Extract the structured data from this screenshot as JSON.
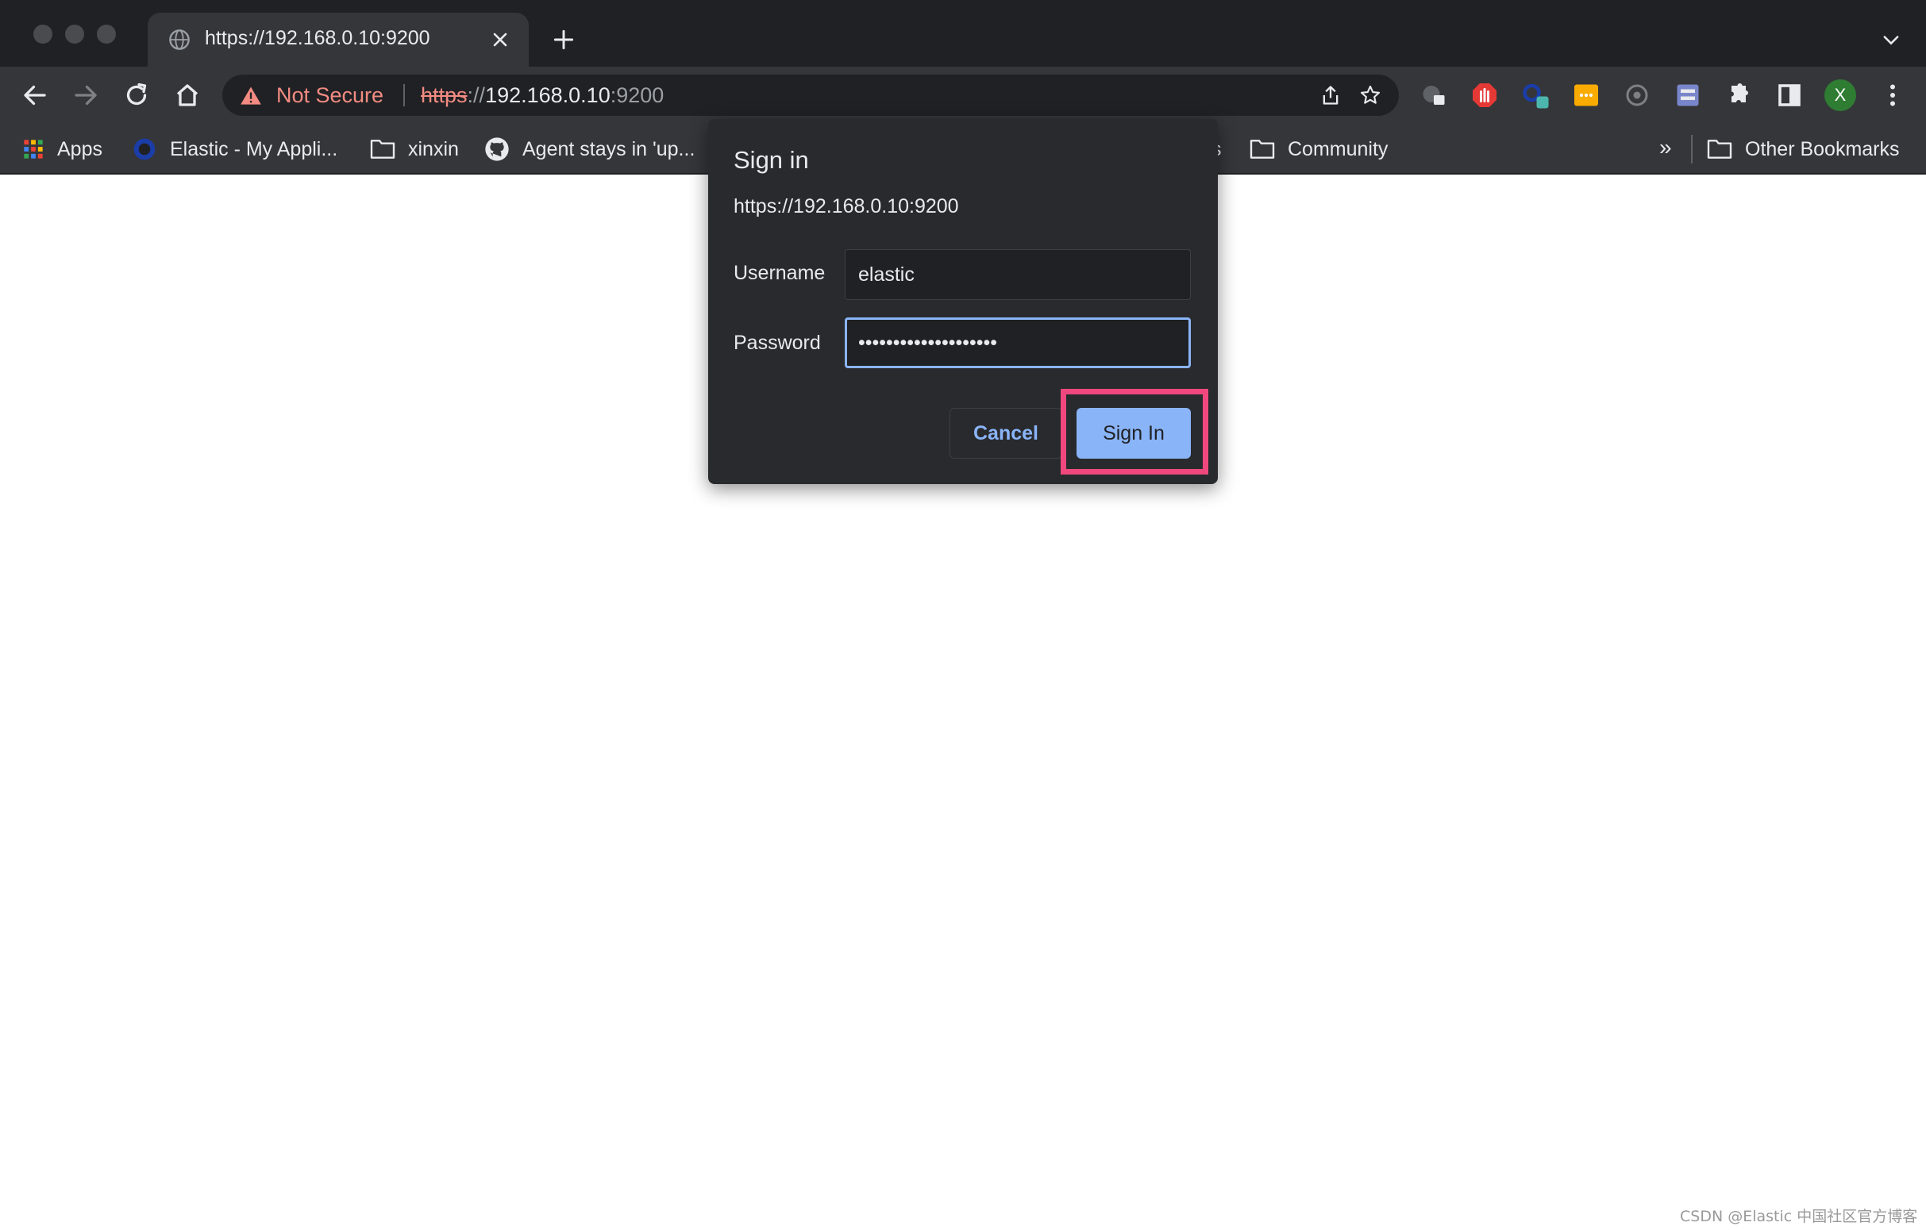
{
  "tab": {
    "title": "https://192.168.0.10:9200"
  },
  "omnibox": {
    "security_label": "Not Secure",
    "url_scheme": "https",
    "url_sep": "://",
    "url_host": "192.168.0.10",
    "url_port": ":9200"
  },
  "profile": {
    "initial": "X"
  },
  "bookmarks": {
    "items": [
      {
        "label": "Apps",
        "icon": "apps-grid-icon"
      },
      {
        "label": "Elastic - My Appli...",
        "icon": "elastic-logo-icon"
      },
      {
        "label": "xinxin",
        "icon": "folder-icon"
      },
      {
        "label": "Agent stays in 'up...",
        "icon": "github-icon"
      },
      {
        "label": "s",
        "icon": ""
      },
      {
        "label": "Community",
        "icon": "folder-icon"
      },
      {
        "label": "Other Bookmarks",
        "icon": "folder-icon"
      }
    ],
    "overflow": "»"
  },
  "dialog": {
    "title": "Sign in",
    "origin": "https://192.168.0.10:9200",
    "username_label": "Username",
    "username_value": "elastic",
    "password_label": "Password",
    "password_value": "••••••••••••••••••••",
    "cancel_label": "Cancel",
    "signin_label": "Sign In"
  },
  "colors": {
    "chrome_dark": "#202124",
    "toolbar": "#35363a",
    "dialog_bg": "#292a2d",
    "accent": "#8ab4f8",
    "warning": "#f28b82",
    "highlight": "#f0487e"
  },
  "watermark": "CSDN @Elastic 中国社区官方博客"
}
